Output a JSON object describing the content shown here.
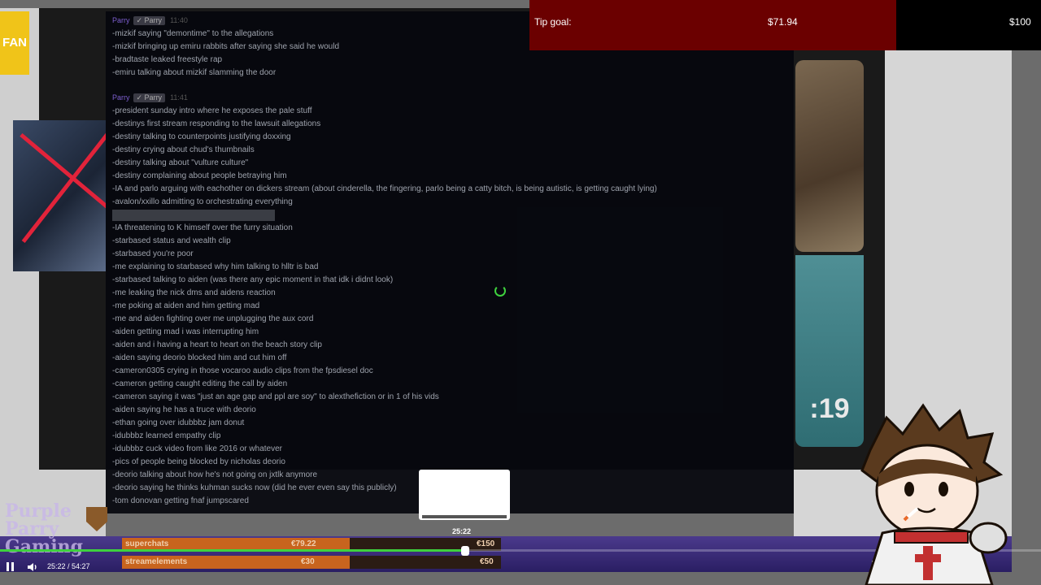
{
  "tip_goal": {
    "label": "Tip goal:",
    "current": "$71.94",
    "target": "$100",
    "progress": 0.7194
  },
  "chat": {
    "messages": [
      {
        "user": "Parry",
        "badge": "✓ Parry",
        "time": "11:40",
        "lines": [
          "-mizkif saying \"demontime\" to the allegations",
          "-mizkif bringing up emiru rabbits after saying she said he would",
          "-bradtaste leaked freestyle rap",
          "-emiru talking about mizkif slamming the door"
        ]
      },
      {
        "user": "Parry",
        "badge": "✓ Parry",
        "time": "11:41",
        "lines": [
          "-president sunday intro where he exposes the pale stuff",
          "-destinys first stream responding to the lawsuit allegations",
          "-destiny talking to counterpoints justifying doxxing",
          "-destiny crying about chud's thumbnails",
          "-destiny talking about \"vulture culture\"",
          "-destiny complaining about people betraying him",
          "-IA and parlo arguing with eachother on dickers stream (about cinderella, the fingering, parlo being a catty bitch, is being autistic, is getting caught lying)",
          "-avalon/xxillo admitting to orchestrating everything"
        ]
      },
      {
        "user": "",
        "badge": "",
        "time": "",
        "lines": [
          "-IA threatening to K himself over the furry situation",
          "-starbased status and wealth clip",
          "-starbased you're poor",
          "-me explaining to starbased why him talking to hlltr is bad",
          "-starbased talking to aiden (was there any epic moment in that idk i didnt look)",
          "-me leaking the nick dms and aidens reaction",
          "-me poking at aiden and him getting mad",
          "-me and aiden fighting over me unplugging the aux cord",
          "-aiden getting mad i was interrupting him",
          "-aiden and i having a heart to heart on the beach story clip",
          "-aiden saying deorio blocked him and cut him off",
          "-cameron0305 crying in those vocaroo audio clips from the fpsdiesel doc",
          "-cameron getting caught editing the call by aiden",
          "-cameron saying it was \"just an age gap and ppl are soy\" to alexthefiction or in 1 of his vids",
          "-aiden saying he has a truce with deorio",
          "-ethan going over idubbbz jam donut",
          "-idubbbz learned empathy clip",
          "-idubbbz cuck video from like 2016 or whatever",
          "-pics of people being blocked by nicholas deorio",
          "-deorio talking about how he's not going on jxtlk anymore",
          "-deorio saying he thinks kuhman sucks now (did he ever even say this publicly)",
          "-tom donovan getting fnaf jumpscared"
        ]
      }
    ]
  },
  "player": {
    "time_current": "25:22",
    "time_total": "54:27",
    "time_display": "25:22 / 54:27",
    "hover_time": "25:22",
    "progress": 0.4659
  },
  "overlay": {
    "logo_text": "Purple Parry Gaming",
    "fan_badge": "FAN",
    "timer_text": ":19",
    "goals": [
      {
        "name": "superchats",
        "current": "€79.22",
        "target": "€150",
        "progress": 0.53
      },
      {
        "name": "streamelements",
        "current": "€30",
        "target": "€50",
        "progress": 0.6
      }
    ]
  },
  "colors": {
    "tip_fill": "#6b0000",
    "progress": "#3ed13e",
    "chat_bg": "#06080e",
    "username": "#7d5fd0"
  }
}
